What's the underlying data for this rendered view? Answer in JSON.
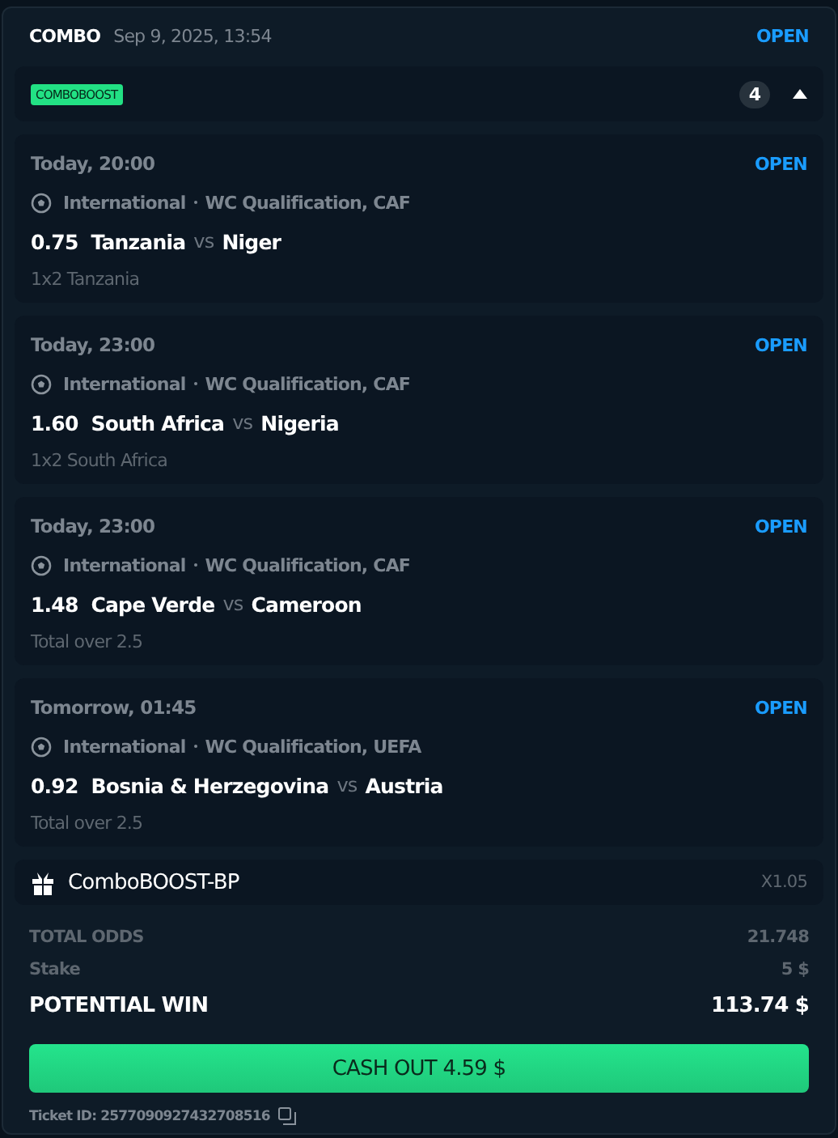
{
  "bet": {
    "type": "COMBO",
    "date": "Sep 9, 2025, 13:54",
    "status": "OPEN"
  },
  "boost_bar": {
    "badge": "COMBOBOOST",
    "count": "4",
    "expanded": true
  },
  "legs": [
    {
      "time": "Today, 20:00",
      "status": "OPEN",
      "category": "International",
      "league": "WC Qualification, CAF",
      "odds": "0.75",
      "home": "Tanzania",
      "vs": "vs",
      "away": "Niger",
      "market": "1x2 Tanzania"
    },
    {
      "time": "Today, 23:00",
      "status": "OPEN",
      "category": "International",
      "league": "WC Qualification, CAF",
      "odds": "1.60",
      "home": "South Africa",
      "vs": "vs",
      "away": "Nigeria",
      "market": "1x2 South Africa"
    },
    {
      "time": "Today, 23:00",
      "status": "OPEN",
      "category": "International",
      "league": "WC Qualification, CAF",
      "odds": "1.48",
      "home": "Cape Verde",
      "vs": "vs",
      "away": "Cameroon",
      "market": "Total over 2.5"
    },
    {
      "time": "Tomorrow, 01:45",
      "status": "OPEN",
      "category": "International",
      "league": "WC Qualification, UEFA",
      "odds": "0.92",
      "home": "Bosnia & Herzegovina",
      "vs": "vs",
      "away": "Austria",
      "market": "Total over 2.5"
    }
  ],
  "boost": {
    "name": "ComboBOOST-BP",
    "multiplier": "X1.05"
  },
  "summary": [
    {
      "kind": "muted",
      "label": "TOTAL ODDS",
      "value": "21.748"
    },
    {
      "kind": "muted",
      "label": "Stake",
      "value": "5 $"
    },
    {
      "kind": "strong",
      "label": "POTENTIAL WIN",
      "value": "113.74 $"
    }
  ],
  "cashout_button": "CASH OUT 4.59 $",
  "ticket_id": "Ticket ID: 2577090927432708516"
}
